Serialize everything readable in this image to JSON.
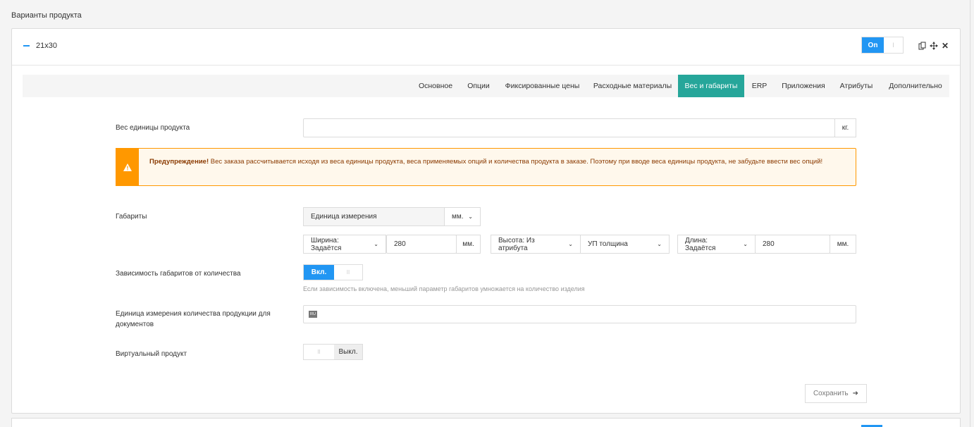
{
  "section": {
    "title": "Варианты продукта"
  },
  "variant": {
    "name": "21x30",
    "toggle_on_label": "On",
    "toggle_knob": "I",
    "icons": [
      "copy-icon",
      "move-icon",
      "close-icon"
    ]
  },
  "tabs": [
    {
      "label": "Основное"
    },
    {
      "label": "Опции"
    },
    {
      "label": "Фиксированные цены"
    },
    {
      "label": "Расходные материалы"
    },
    {
      "label": "Вес и габариты",
      "active": true
    },
    {
      "label": "ERP"
    },
    {
      "label": "Приложения"
    },
    {
      "label": "Атрибуты"
    },
    {
      "label": "Дополнительно"
    }
  ],
  "weight": {
    "label": "Вес единицы продукта",
    "value": "",
    "unit": "кг."
  },
  "warning": {
    "icon": "warning-icon",
    "title": "Предупреждение!",
    "text": " Вес заказа рассчитывается исходя из веса единицы продукта, веса применяемых опций и количества продукта в заказе. Поэтому при вводе веса единицы продукта, не забудьте ввести вес опций!"
  },
  "dimensions": {
    "label": "Габариты",
    "unit_label": "Единица измерения",
    "unit_value": "мм.",
    "width_mode": "Ширина: Задаётся",
    "width_value": "280",
    "width_unit": "мм.",
    "height_mode": "Высота: Из атрибута",
    "height_attr": "УП толщина",
    "length_mode": "Длина: Задаётся",
    "length_value": "280",
    "length_unit": "мм."
  },
  "dependency": {
    "label": "Зависимость габаритов от количества",
    "toggle_label": "Вкл.",
    "toggle_knob": "II",
    "hint": "Если зависимость включена, меньший параметр габаритов умножается на количество изделия"
  },
  "doc_unit": {
    "label": "Единица измерения количества продукции для документов",
    "lang_badge": "RU",
    "value": ""
  },
  "virtual": {
    "label": "Виртуальный продукт",
    "toggle_knob": "II",
    "toggle_label": "Выкл."
  },
  "save": {
    "label": "Сохранить",
    "icon": "arrow-right-icon"
  },
  "colors": {
    "accent": "#2196f3",
    "tab_active": "#26a69a",
    "warning": "#ff9800"
  }
}
